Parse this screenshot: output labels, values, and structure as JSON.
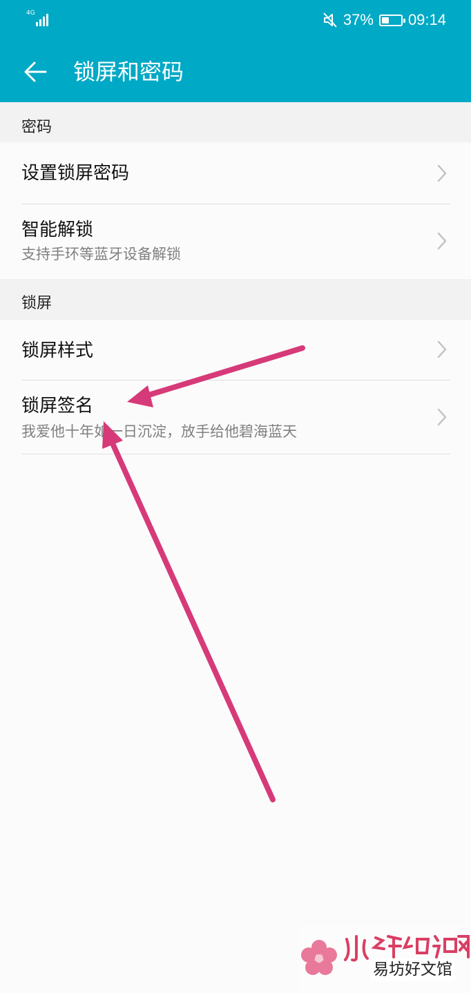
{
  "status_bar": {
    "network": "4G",
    "battery_percent": 37,
    "battery_text": "37%",
    "time": "09:14"
  },
  "app_bar": {
    "title": "锁屏和密码"
  },
  "sections": [
    {
      "header": "密码",
      "items": [
        {
          "title": "设置锁屏密码",
          "subtitle": ""
        },
        {
          "title": "智能解锁",
          "subtitle": "支持手环等蓝牙设备解锁"
        }
      ]
    },
    {
      "header": "锁屏",
      "items": [
        {
          "title": "锁屏样式",
          "subtitle": ""
        },
        {
          "title": "锁屏签名",
          "subtitle": "我爱他十年如一日沉淀，放手给他碧海蓝天"
        }
      ]
    }
  ],
  "annotation": {
    "arrow_color": "#d63a78"
  },
  "colors": {
    "accent": "#00a9c5",
    "background": "#fcfbfc",
    "section_bg": "#f3f2f3"
  },
  "icons": {
    "back": "back-arrow-icon",
    "chevron": "chevron-right-icon",
    "mute": "mute-icon"
  },
  "watermark": {
    "logo_text": "小樱知识网",
    "subtitle": "易坊好文馆"
  }
}
